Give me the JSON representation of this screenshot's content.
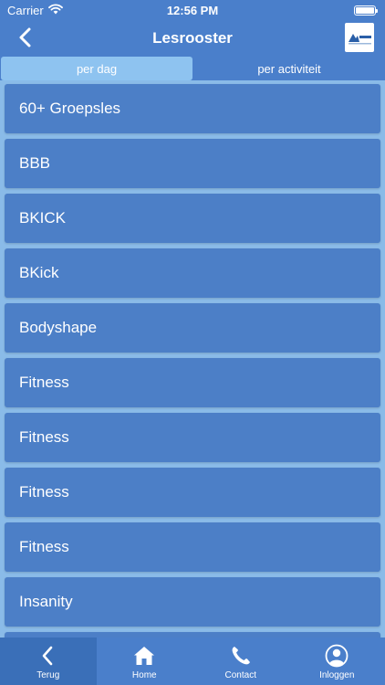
{
  "status_bar": {
    "carrier": "Carrier",
    "time": "12:56 PM"
  },
  "nav": {
    "title": "Lesrooster",
    "logo_text": "Medifit"
  },
  "segments": [
    {
      "label": "per dag",
      "active": true
    },
    {
      "label": "per activiteit",
      "active": false
    }
  ],
  "list": {
    "items": [
      {
        "label": "60+ Groepsles"
      },
      {
        "label": "BBB"
      },
      {
        "label": "BKICK"
      },
      {
        "label": "BKick"
      },
      {
        "label": "Bodyshape"
      },
      {
        "label": "Fitness"
      },
      {
        "label": "Fitness"
      },
      {
        "label": "Fitness"
      },
      {
        "label": "Fitness"
      },
      {
        "label": "Insanity"
      }
    ]
  },
  "tabbar": {
    "back_label": "Terug",
    "home_label": "Home",
    "contact_label": "Contact",
    "login_label": "Inloggen"
  },
  "colors": {
    "header_bg": "#4a7fcb",
    "list_bg": "#8abbe8",
    "item_bg": "#4c7fc7",
    "segment_active": "#8ec3f0"
  }
}
